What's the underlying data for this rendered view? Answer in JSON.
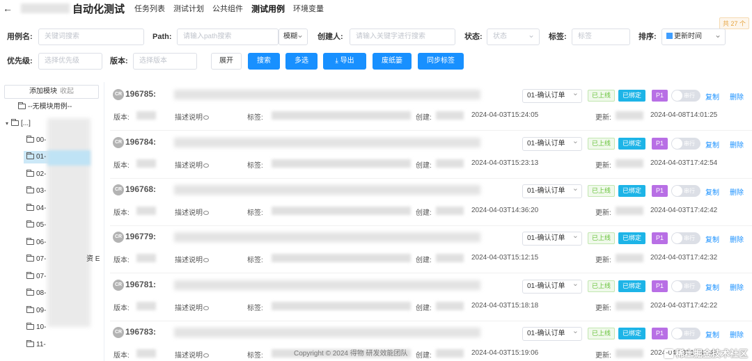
{
  "header": {
    "back_icon": "arrow-left-icon",
    "title": "自动化测试",
    "nav": [
      "任务列表",
      "测试计划",
      "公共组件",
      "测试用例",
      "环境变量"
    ],
    "active_nav": "测试用例",
    "total": "共 27 个"
  },
  "filters": {
    "case_name_label": "用例名:",
    "case_name_placeholder": "关键词搜索",
    "path_label": "Path:",
    "path_placeholder": "请输入path搜索",
    "path_mode": "模糊",
    "creator_label": "创建人:",
    "creator_placeholder": "请输入关键字进行搜索",
    "status_label": "状态:",
    "status_placeholder": "状态",
    "tag_label": "标签:",
    "tag_placeholder": "标签",
    "sort_label": "排序:",
    "sort_value": "更新时间",
    "priority_label": "优先级:",
    "priority_placeholder": "选择优先级",
    "version_label": "版本:",
    "version_placeholder": "选择版本"
  },
  "buttons": {
    "expand": "展开",
    "search": "搜索",
    "multi_select": "多选",
    "export": "导出",
    "trash": "废纸篓",
    "sync_tags": "同步标签"
  },
  "sidebar": {
    "add_module": "添加模块",
    "collapse": "收起",
    "items": [
      "--无模块用例--",
      "[...]",
      "00-",
      "01-",
      "02-",
      "03-",
      "04-",
      "05-",
      "06-",
      "07-",
      "07-",
      "08-",
      "09-",
      "10-",
      "11-"
    ],
    "partial_text": "资 E"
  },
  "case_labels": {
    "version": "版本:",
    "description": "描述说明",
    "tags": "标签:",
    "created": "创建:",
    "updated": "更新:",
    "stage": "01-确认订单",
    "online": "已上线",
    "bound": "已绑定",
    "priority": "P1",
    "serial": "串行",
    "copy": "复制",
    "delete": "删除",
    "cr": "CR"
  },
  "cases": [
    {
      "id": "196785:",
      "created": "2024-04-03T15:24:05",
      "updated": "2024-04-08T14:01:25"
    },
    {
      "id": "196784:",
      "created": "2024-04-03T15:23:13",
      "updated": "2024-04-03T17:42:54"
    },
    {
      "id": "196768:",
      "created": "2024-04-03T14:36:20",
      "updated": "2024-04-03T17:42:42"
    },
    {
      "id": "196779:",
      "created": "2024-04-03T15:12:15",
      "updated": "2024-04-03T17:42:32"
    },
    {
      "id": "196781:",
      "created": "2024-04-03T15:18:18",
      "updated": "2024-04-03T17:42:22"
    },
    {
      "id": "196783:",
      "created": "2024-04-03T15:19:06",
      "updated": "2024-04-03T17:41:48"
    }
  ],
  "footer": "Copyright © 2024 得物 研发效能团队",
  "watermark": "稀土掘金技术社区"
}
